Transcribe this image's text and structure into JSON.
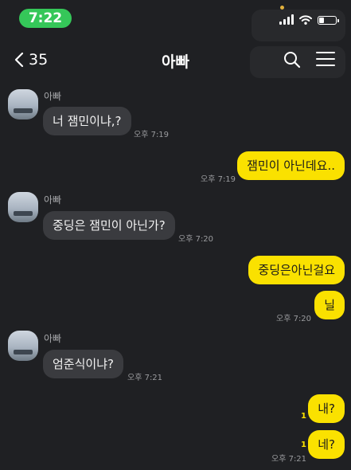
{
  "status_bar": {
    "time": "7:22",
    "battery_level": 0.3
  },
  "header": {
    "back_count": "35",
    "title": "아빠"
  },
  "messages": [
    {
      "sender": "아빠",
      "text": "너 잼민이냐,?",
      "time": "오후 7:19"
    },
    {
      "text": "잼민이 아닌데요..",
      "time": "오후 7:19"
    },
    {
      "sender": "아빠",
      "text": "중딩은 잼민이 아닌가?",
      "time": "오후 7:20"
    },
    {
      "text": "중딩은아닌걸요"
    },
    {
      "text": "닐",
      "time": "오후 7:20"
    },
    {
      "sender": "아빠",
      "text": "엄준식이냐?",
      "time": "오후 7:21"
    },
    {
      "text": "내?",
      "unread": "1"
    },
    {
      "text": "네?",
      "unread": "1",
      "time": "오후 7:21"
    }
  ],
  "colors": {
    "background": "#1f2023",
    "outgoing_bubble": "#fae100",
    "incoming_bubble": "#3a3b3f",
    "status_time": "#35c759"
  }
}
